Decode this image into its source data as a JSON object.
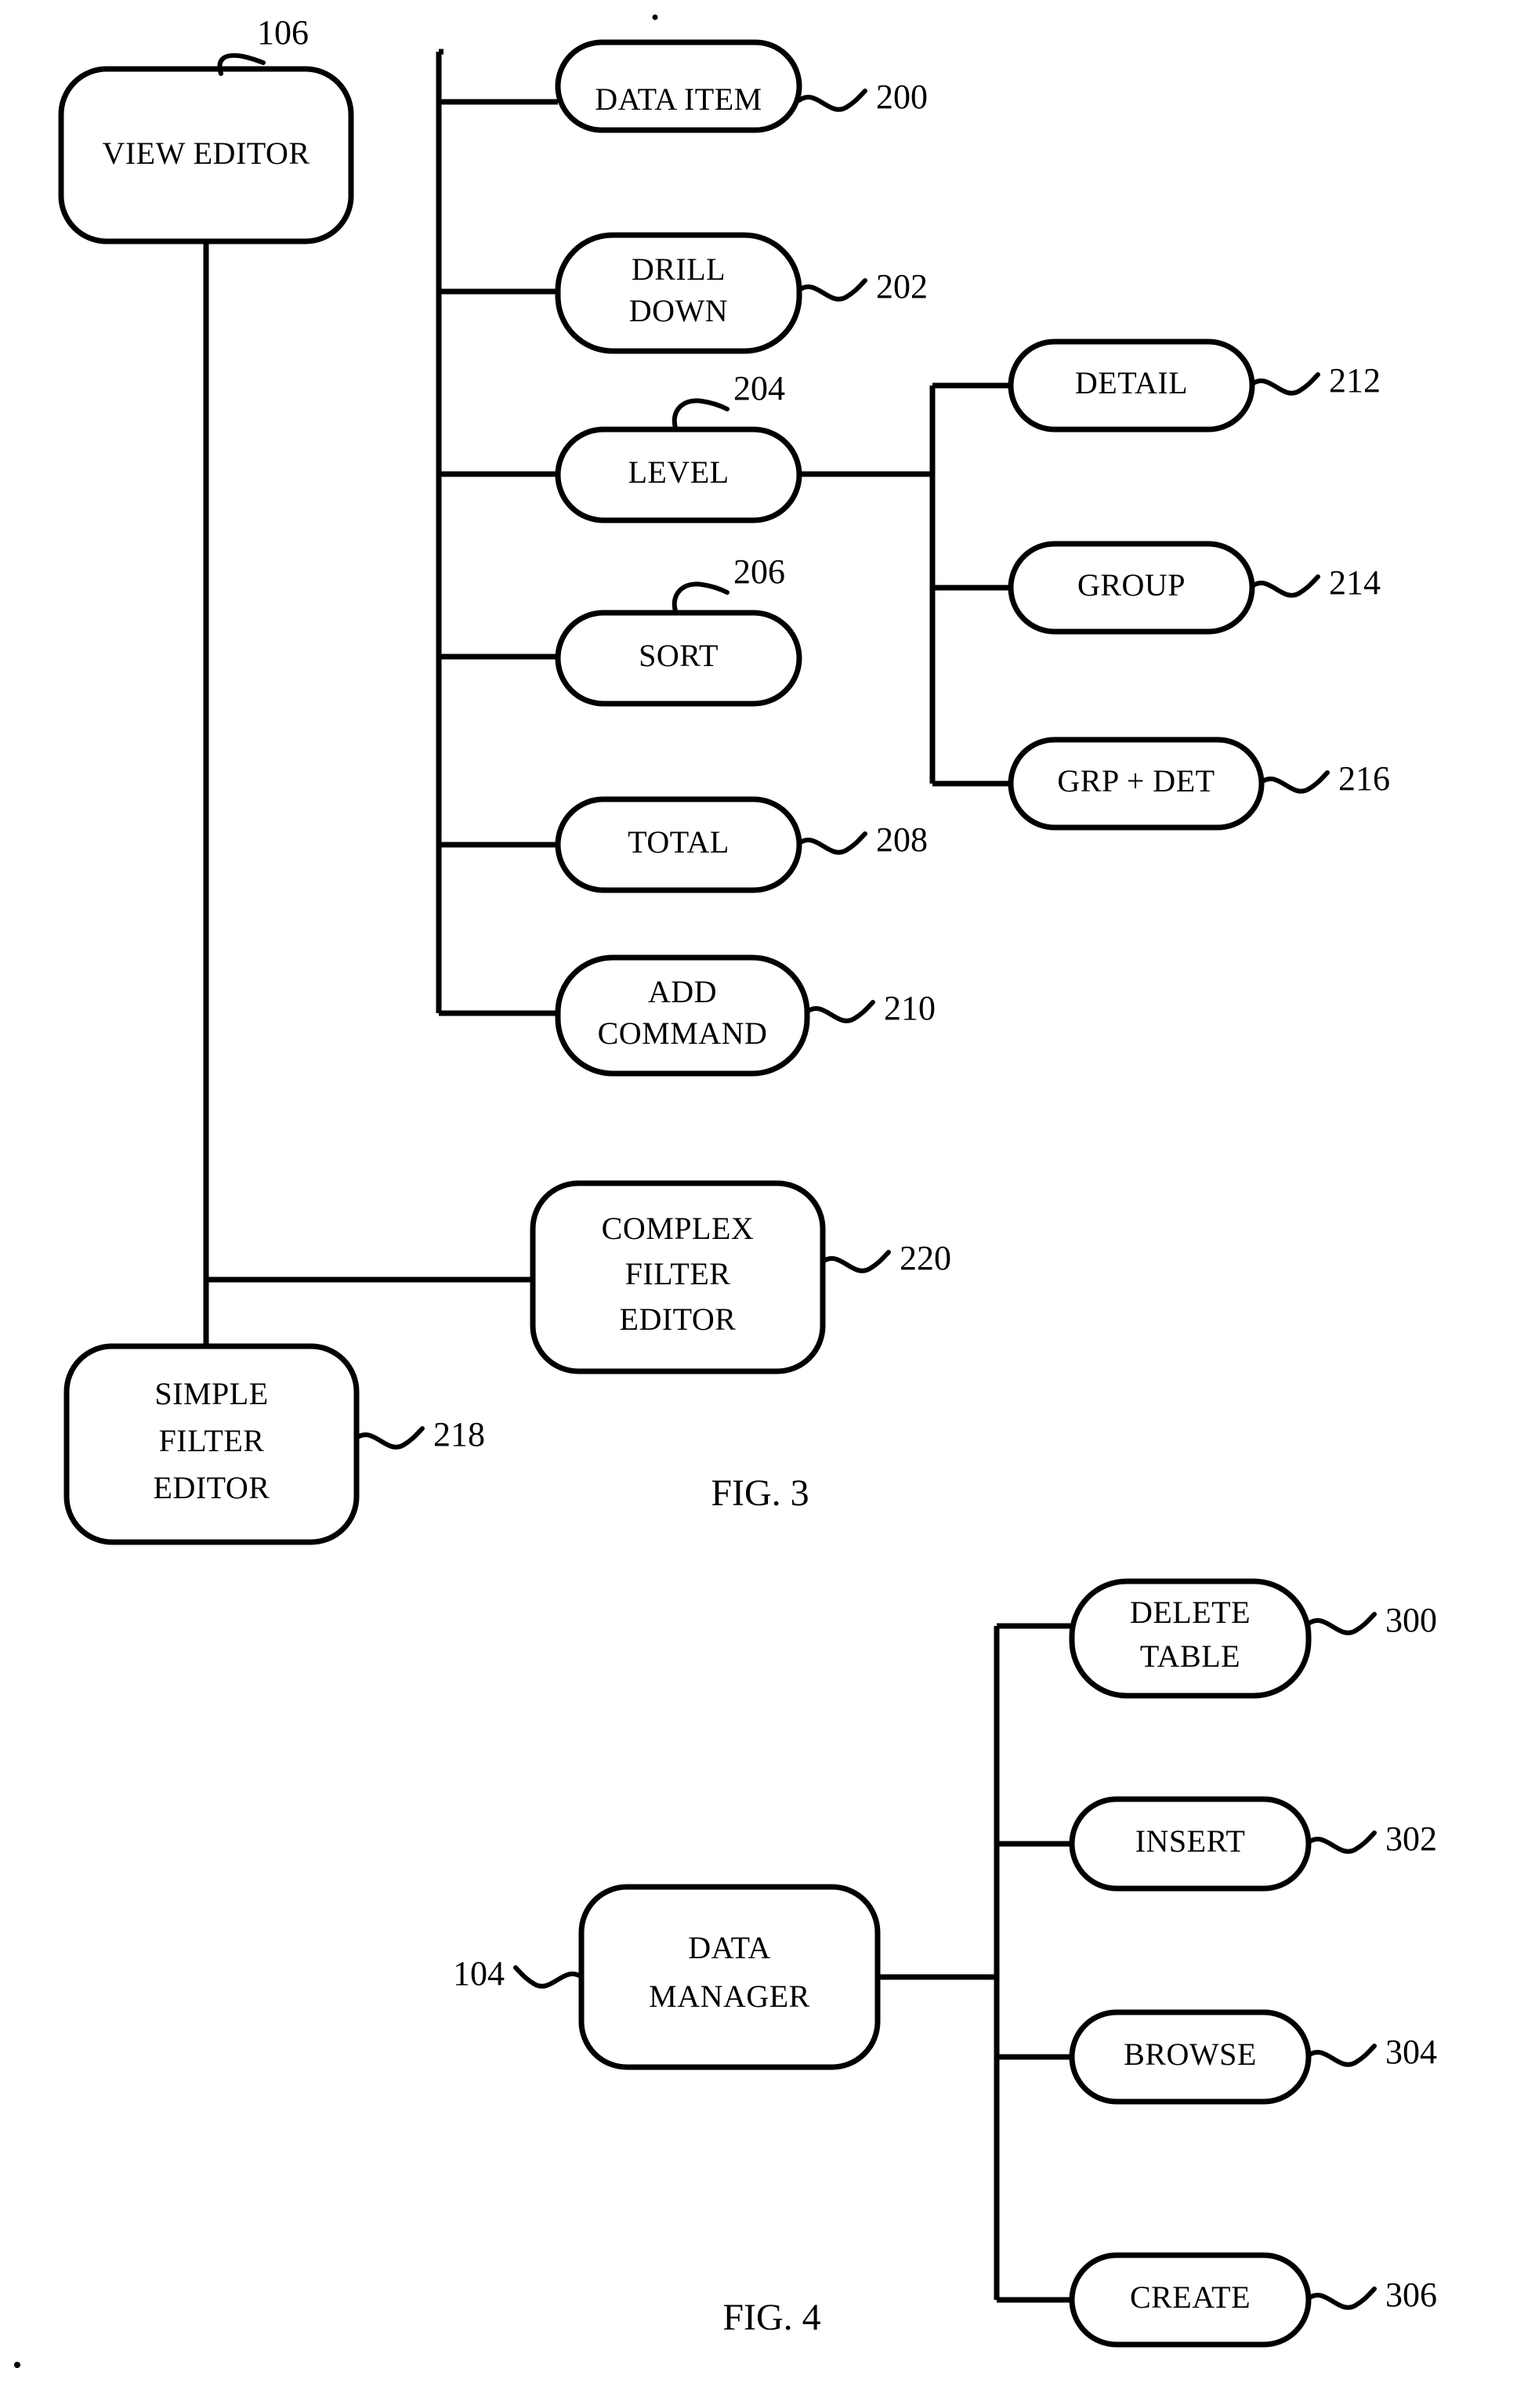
{
  "document": {
    "type": "patent-figure-sheet",
    "figures": [
      "FIG. 3",
      "FIG. 4"
    ]
  },
  "fig3": {
    "caption": "FIG. 3",
    "root": {
      "label_line1": "VIEW EDITOR",
      "ref": "106"
    },
    "branches": [
      {
        "label_line1": "DATA ITEM",
        "label_line2": "",
        "ref": "200"
      },
      {
        "label_line1": "DRILL",
        "label_line2": "DOWN",
        "ref": "202"
      },
      {
        "label_line1": "LEVEL",
        "label_line2": "",
        "ref": "204"
      },
      {
        "label_line1": "SORT",
        "label_line2": "",
        "ref": "206"
      },
      {
        "label_line1": "TOTAL",
        "label_line2": "",
        "ref": "208"
      },
      {
        "label_line1": "ADD",
        "label_line2": "COMMAND",
        "ref": "210"
      }
    ],
    "level_children": [
      {
        "label_line1": "DETAIL",
        "ref": "212"
      },
      {
        "label_line1": "GROUP",
        "ref": "214"
      },
      {
        "label_line1": "GRP + DET",
        "ref": "216"
      }
    ],
    "filters": [
      {
        "label_line1": "COMPLEX",
        "label_line2": "FILTER",
        "label_line3": "EDITOR",
        "ref": "220"
      },
      {
        "label_line1": "SIMPLE",
        "label_line2": "FILTER",
        "label_line3": "EDITOR",
        "ref": "218"
      }
    ]
  },
  "fig4": {
    "caption": "FIG. 4",
    "root": {
      "label_line1": "DATA",
      "label_line2": "MANAGER",
      "ref": "104"
    },
    "branches": [
      {
        "label_line1": "DELETE",
        "label_line2": "TABLE",
        "ref": "300"
      },
      {
        "label_line1": "INSERT",
        "label_line2": "",
        "ref": "302"
      },
      {
        "label_line1": "BROWSE",
        "label_line2": "",
        "ref": "304"
      },
      {
        "label_line1": "CREATE",
        "label_line2": "",
        "ref": "306"
      }
    ]
  },
  "style": {
    "ink": "#000000",
    "paper": "#ffffff"
  }
}
